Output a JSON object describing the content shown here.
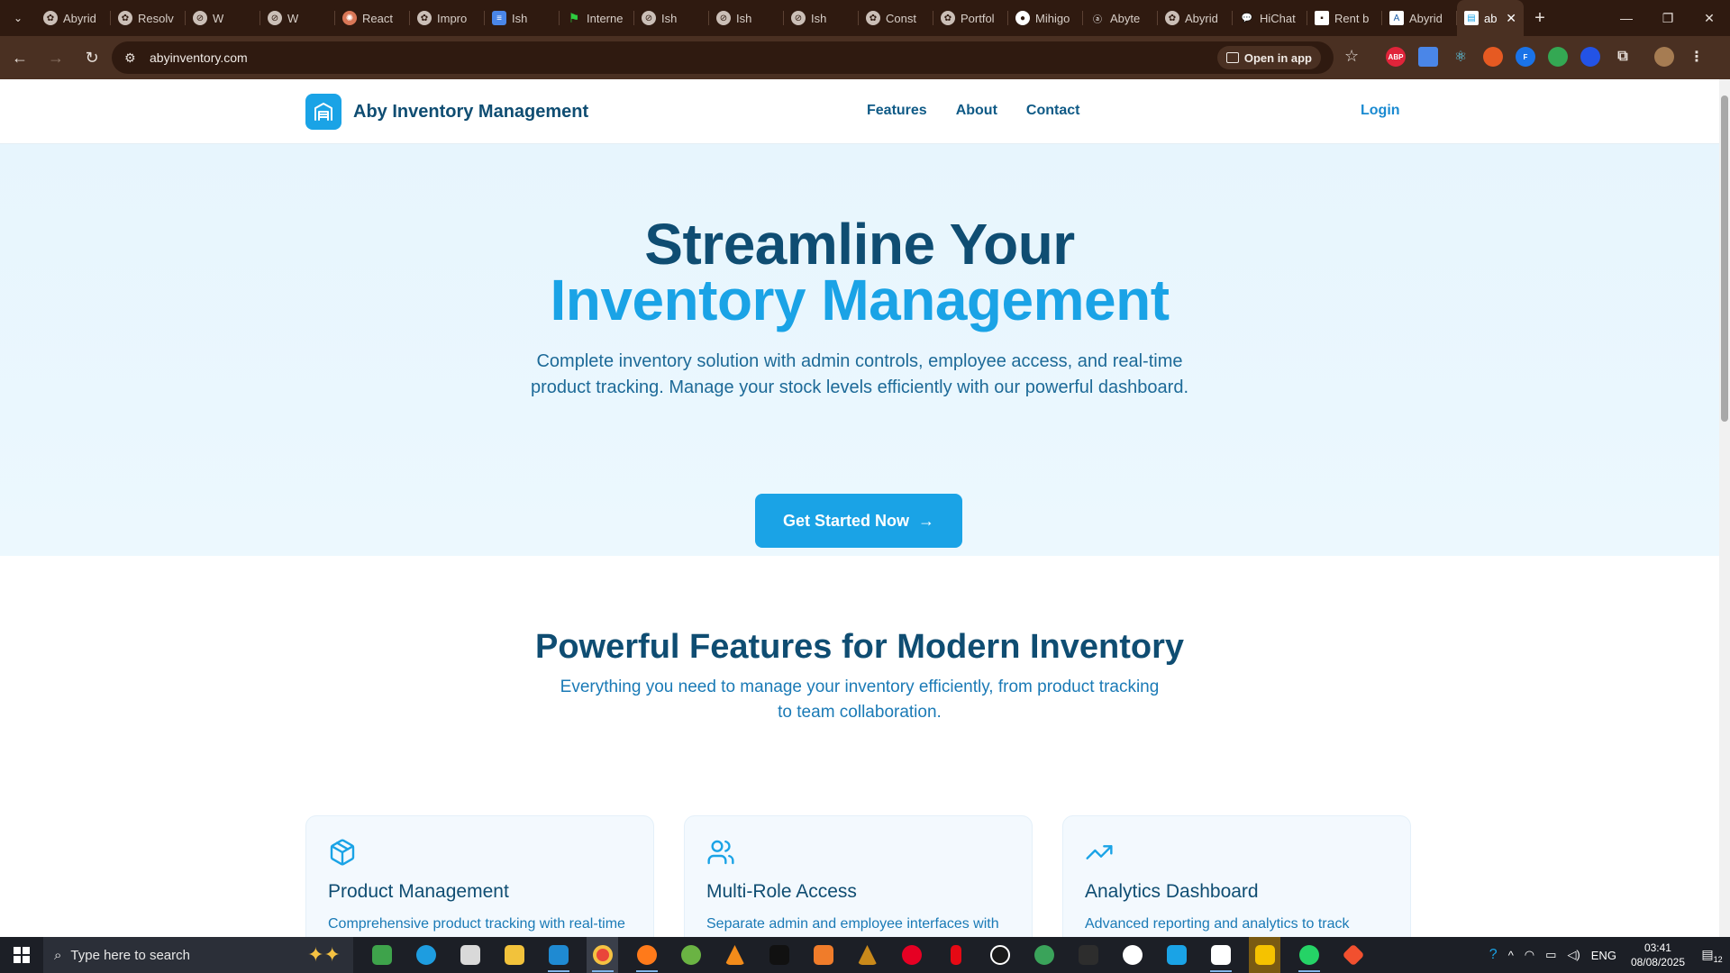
{
  "browser": {
    "tabs": [
      {
        "label": "Abyrid",
        "favicon": "openai-icon"
      },
      {
        "label": "Resolv",
        "favicon": "openai-icon"
      },
      {
        "label": "W",
        "favicon": "link-icon"
      },
      {
        "label": "W",
        "favicon": "link-icon"
      },
      {
        "label": "React",
        "favicon": "claude-icon"
      },
      {
        "label": "Impro",
        "favicon": "openai-icon"
      },
      {
        "label": "Ish",
        "favicon": "docs-icon"
      },
      {
        "label": "Interne",
        "favicon": "flag-icon"
      },
      {
        "label": "Ish",
        "favicon": "link-icon"
      },
      {
        "label": "Ish",
        "favicon": "link-icon"
      },
      {
        "label": "Ish",
        "favicon": "link-icon"
      },
      {
        "label": "Const",
        "favicon": "openai-icon"
      },
      {
        "label": "Portfol",
        "favicon": "openai-icon"
      },
      {
        "label": "Mihigo",
        "favicon": "github-icon"
      },
      {
        "label": "Abyte",
        "favicon": "vercel-icon"
      },
      {
        "label": "Abyrid",
        "favicon": "openai-icon"
      },
      {
        "label": "HiChat",
        "favicon": "chat-icon"
      },
      {
        "label": "Rent b",
        "favicon": "page-icon"
      },
      {
        "label": "Abyrid",
        "favicon": "azure-icon"
      }
    ],
    "active_tab": {
      "label": "ab"
    },
    "url": "abyinventory.com",
    "open_in_app": "Open in app"
  },
  "site": {
    "brand": "Aby Inventory Management",
    "nav": [
      "Features",
      "About",
      "Contact"
    ],
    "login": "Login"
  },
  "hero": {
    "title_line1": "Streamline Your",
    "title_line2": "Inventory Management",
    "description": "Complete inventory solution with admin controls, employee access, and real-time product tracking. Manage your stock levels efficiently with our powerful dashboard.",
    "cta": "Get Started Now"
  },
  "features": {
    "heading": "Powerful Features for Modern Inventory",
    "subheading": "Everything you need to manage your inventory efficiently, from product tracking to team collaboration.",
    "cards": [
      {
        "icon": "box-icon",
        "title": "Product Management",
        "text": "Comprehensive product tracking with real-time inventory updates and automated stock alerts."
      },
      {
        "icon": "users-icon",
        "title": "Multi-Role Access",
        "text": "Separate admin and employee interfaces with role-based permissions and access controls."
      },
      {
        "icon": "trending-up-icon",
        "title": "Analytics Dashboard",
        "text": "Advanced reporting and analytics to track inventory trends and optimize stock levels."
      }
    ]
  },
  "taskbar": {
    "search_placeholder": "Type here to search",
    "language": "ENG",
    "time": "03:41",
    "date": "08/08/2025",
    "notifications": "12"
  },
  "colors": {
    "primary": "#1aa3e6",
    "navy": "#0f4d72",
    "chrome": "#2f1a10"
  }
}
